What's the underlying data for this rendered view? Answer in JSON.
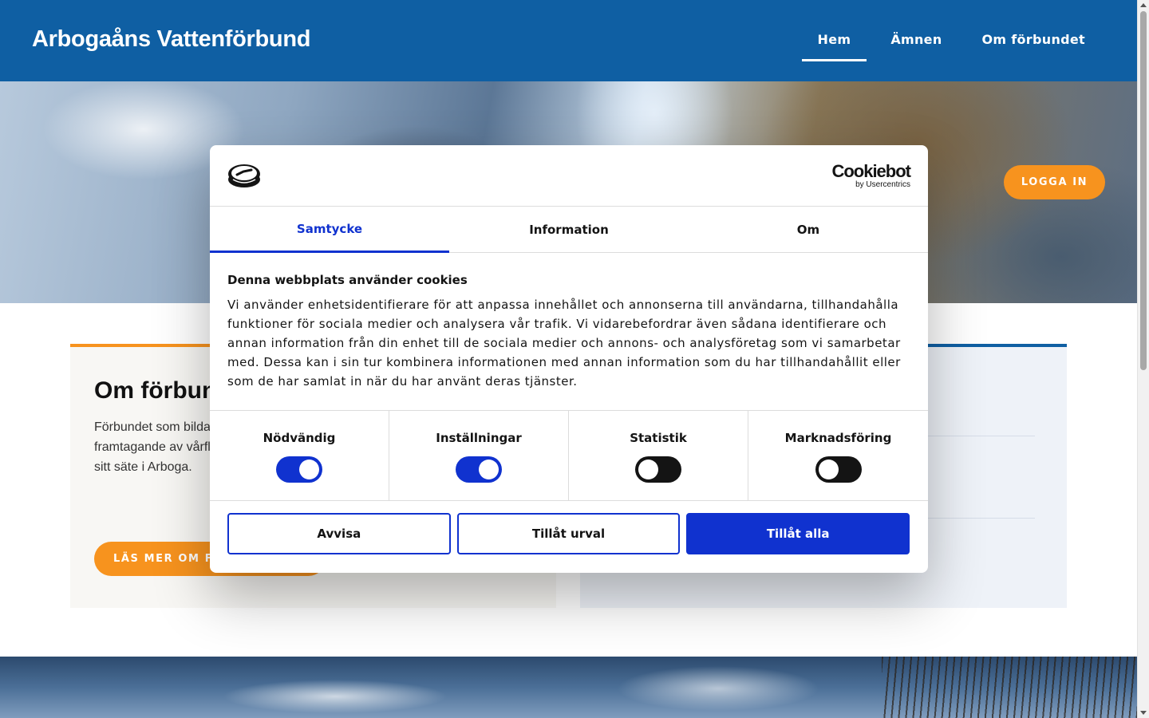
{
  "header": {
    "site_title": "Arbogaåns Vattenförbund",
    "nav": [
      {
        "label": "Hem",
        "active": true
      },
      {
        "label": "Ämnen",
        "active": false
      },
      {
        "label": "Om förbundet",
        "active": false
      }
    ]
  },
  "hero": {
    "login_label": "LOGGA IN"
  },
  "about_card": {
    "title": "Om förbundet",
    "text": "Förbundet som bildades … har arbetat med recipientkontroll … framtagande av vårflodsprognoser, rensning och underhåll … Förbundet har sitt säte i Arboga.",
    "button_label": "LÄS MER OM FÖRBUNDET"
  },
  "cookie_dialog": {
    "brand_name": "Cookiebot",
    "brand_sub": "by Usercentrics",
    "tabs": [
      {
        "label": "Samtycke",
        "active": true
      },
      {
        "label": "Information",
        "active": false
      },
      {
        "label": "Om",
        "active": false
      }
    ],
    "heading": "Denna webbplats använder cookies",
    "body": "Vi använder enhetsidentifierare för att anpassa innehållet och annonserna till användarna, tillhandahålla funktioner för sociala medier och analysera vår trafik. Vi vidarebefordrar även sådana identifierare och annan information från din enhet till de sociala medier och annons- och analysföretag som vi samarbetar med. Dessa kan i sin tur kombinera informationen med annan information som du har tillhandahållit eller som de har samlat in när du har använt deras tjänster.",
    "categories": [
      {
        "label": "Nödvändig",
        "on": true
      },
      {
        "label": "Inställningar",
        "on": true
      },
      {
        "label": "Statistik",
        "on": false
      },
      {
        "label": "Marknadsföring",
        "on": false
      }
    ],
    "buttons": {
      "deny": "Avvisa",
      "allow_selection": "Tillåt urval",
      "allow_all": "Tillåt alla"
    }
  },
  "colors": {
    "header_blue": "#0f5fa3",
    "accent_orange": "#f7931e",
    "cookiebot_blue": "#1032cf"
  }
}
